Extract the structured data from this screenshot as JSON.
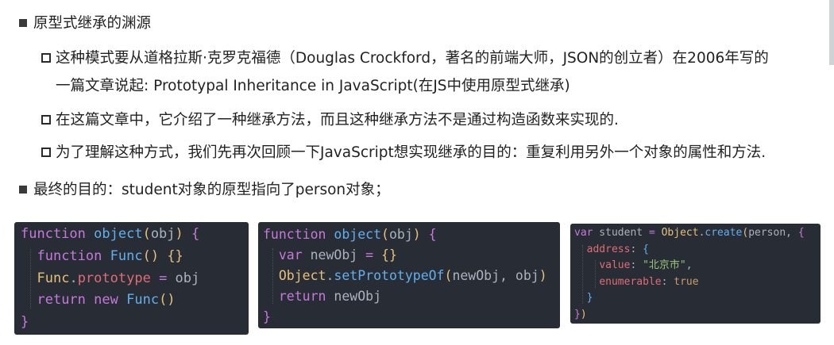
{
  "heading1": "原型式继承的渊源",
  "items": [
    {
      "line1": "这种模式要从道格拉斯·克罗克福德（Douglas Crockford，著名的前端大师，JSON的创立者）在2006年写的",
      "line2": "一篇文章说起: Prototypal Inheritance in JavaScript(在JS中使用原型式继承)"
    },
    {
      "line1": "在这篇文章中，它介绍了一种继承方法，而且这种继承方法不是通过构造函数来实现的."
    },
    {
      "line1": "为了理解这种方式，我们先再次回顾一下JavaScript想实现继承的目的：重复利用另外一个对象的属性和方法."
    }
  ],
  "heading2": "最终的目的：student对象的原型指向了person对象；",
  "code_blocks": [
    {
      "name": "code-object-func",
      "lines": [
        [
          [
            "kw",
            "function"
          ],
          [
            "plain",
            " "
          ],
          [
            "fn",
            "object"
          ],
          [
            "br1",
            "("
          ],
          [
            "plain",
            "obj"
          ],
          [
            "br1",
            ")"
          ],
          [
            "plain",
            " "
          ],
          [
            "br2",
            "{"
          ]
        ],
        [
          [
            "plain",
            "  "
          ],
          [
            "kw",
            "function"
          ],
          [
            "plain",
            " "
          ],
          [
            "fn",
            "Func"
          ],
          [
            "br1",
            "()"
          ],
          [
            "plain",
            " "
          ],
          [
            "br1",
            "{}"
          ]
        ],
        [
          [
            "plain",
            "  "
          ],
          [
            "obj",
            "Func"
          ],
          [
            "plain",
            "."
          ],
          [
            "prop",
            "prototype"
          ],
          [
            "plain",
            " "
          ],
          [
            "kw",
            "="
          ],
          [
            "plain",
            " obj"
          ]
        ],
        [
          [
            "plain",
            "  "
          ],
          [
            "kw",
            "return"
          ],
          [
            "plain",
            " "
          ],
          [
            "kw",
            "new"
          ],
          [
            "plain",
            " "
          ],
          [
            "fn",
            "Func"
          ],
          [
            "br1",
            "()"
          ]
        ],
        [
          [
            "br2",
            "}"
          ]
        ]
      ]
    },
    {
      "name": "code-set-prototype",
      "lines": [
        [
          [
            "kw",
            "function"
          ],
          [
            "plain",
            " "
          ],
          [
            "fn",
            "object"
          ],
          [
            "br1",
            "("
          ],
          [
            "plain",
            "obj"
          ],
          [
            "br1",
            ")"
          ],
          [
            "plain",
            " "
          ],
          [
            "br2",
            "{"
          ]
        ],
        [
          [
            "plain",
            "  "
          ],
          [
            "kw",
            "var"
          ],
          [
            "plain",
            " newObj "
          ],
          [
            "kw",
            "="
          ],
          [
            "plain",
            " "
          ],
          [
            "br1",
            "{}"
          ]
        ],
        [
          [
            "plain",
            "  "
          ],
          [
            "obj",
            "Object"
          ],
          [
            "plain",
            "."
          ],
          [
            "fn",
            "setPrototypeOf"
          ],
          [
            "br1",
            "("
          ],
          [
            "plain",
            "newObj, obj"
          ],
          [
            "br1",
            ")"
          ]
        ],
        [
          [
            "plain",
            "  "
          ],
          [
            "kw",
            "return"
          ],
          [
            "plain",
            " newObj"
          ]
        ],
        [
          [
            "br2",
            "}"
          ]
        ]
      ]
    },
    {
      "name": "code-object-create",
      "lines": [
        [
          [
            "kw",
            "var"
          ],
          [
            "plain",
            " student "
          ],
          [
            "kw",
            "="
          ],
          [
            "plain",
            " "
          ],
          [
            "obj",
            "Object"
          ],
          [
            "plain",
            "."
          ],
          [
            "fn",
            "create"
          ],
          [
            "br1",
            "("
          ],
          [
            "plain",
            "person, "
          ],
          [
            "br2",
            "{"
          ]
        ],
        [
          [
            "plain",
            "  "
          ],
          [
            "prop",
            "address"
          ],
          [
            "plain",
            ": "
          ],
          [
            "fn",
            "{"
          ]
        ],
        [
          [
            "plain",
            "    "
          ],
          [
            "prop",
            "value"
          ],
          [
            "plain",
            ": "
          ],
          [
            "str",
            "\"北京市\""
          ],
          [
            "plain",
            ","
          ]
        ],
        [
          [
            "plain",
            "    "
          ],
          [
            "prop",
            "enumerable"
          ],
          [
            "plain",
            ": "
          ],
          [
            "bool",
            "true"
          ]
        ],
        [
          [
            "plain",
            "  "
          ],
          [
            "fn",
            "}"
          ]
        ],
        [
          [
            "br2",
            "}"
          ],
          [
            "br1",
            ")"
          ]
        ]
      ]
    }
  ]
}
